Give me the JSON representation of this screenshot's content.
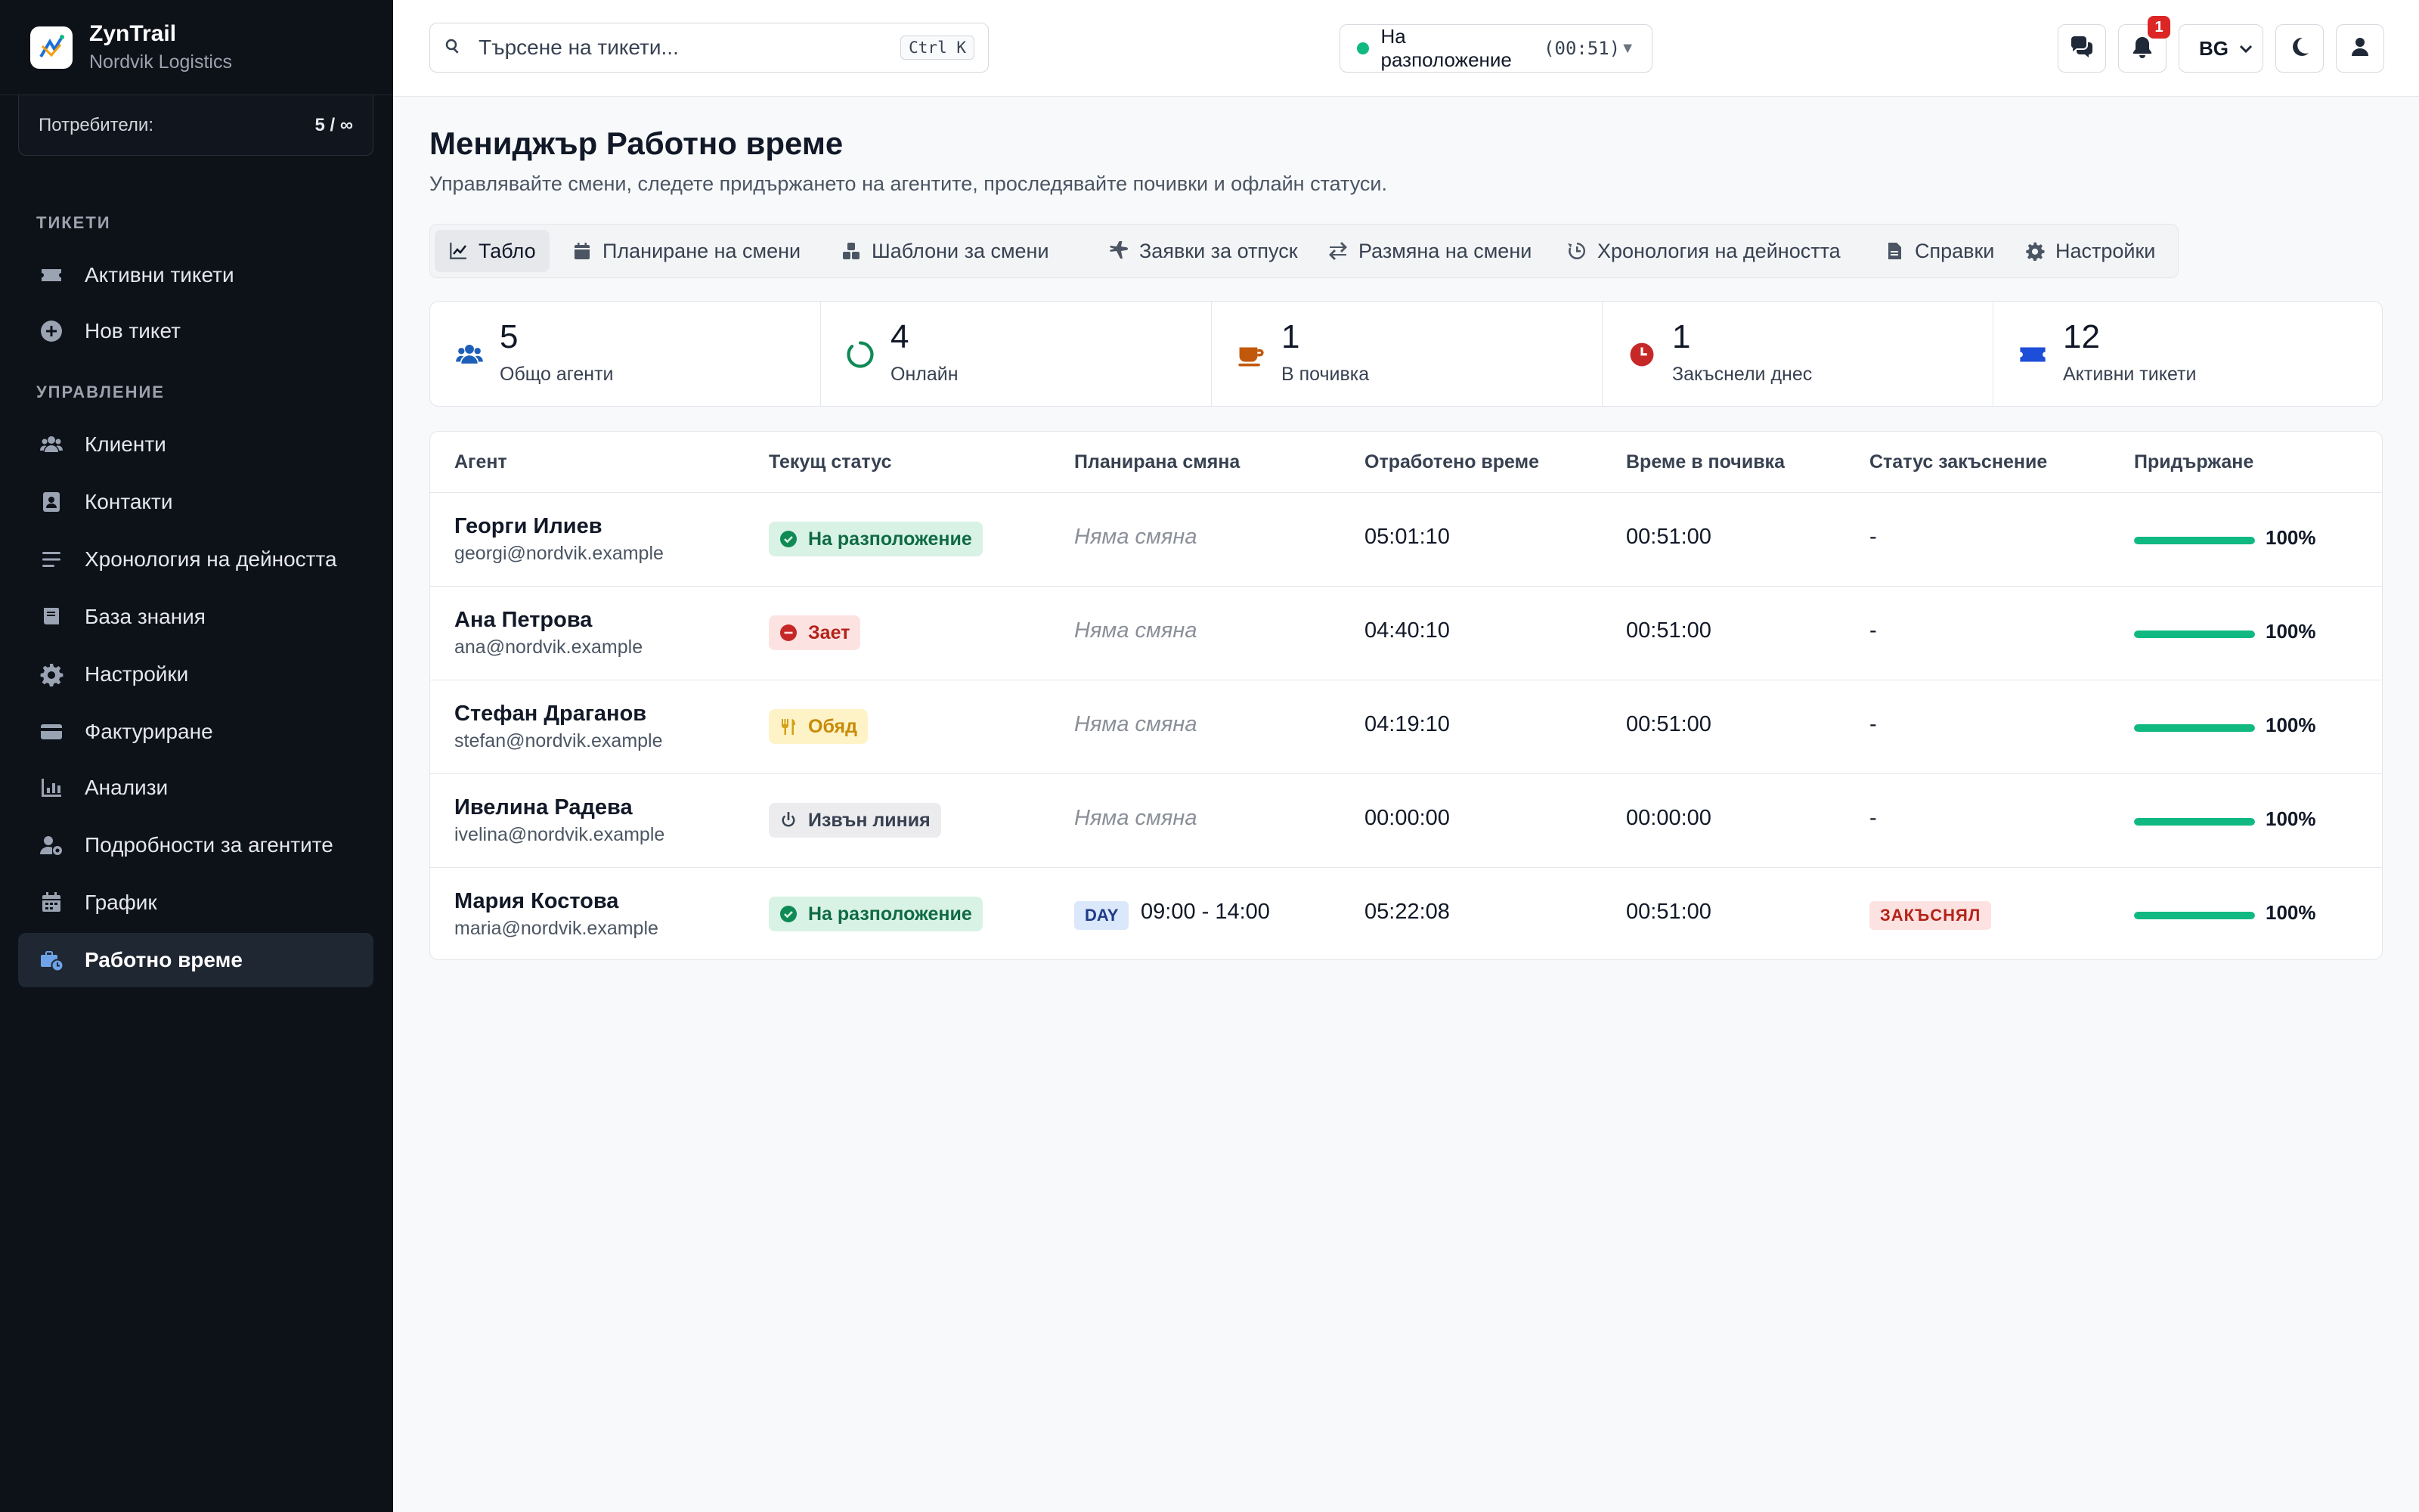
{
  "brand": {
    "name": "ZynTrail",
    "org": "Nordvik Logistics"
  },
  "users": {
    "label": "Потребители:",
    "value": "5 / ∞"
  },
  "sidebar": {
    "section_tickets": "ТИКЕТИ",
    "section_management": "УПРАВЛЕНИЕ",
    "items": [
      {
        "label": "Активни тикети",
        "icon": "ticket-icon"
      },
      {
        "label": "Нов тикет",
        "icon": "plus-circle-icon"
      },
      {
        "label": "Клиенти",
        "icon": "users-icon"
      },
      {
        "label": "Контакти",
        "icon": "address-book-icon"
      },
      {
        "label": "Хронология на дейността",
        "icon": "list-icon"
      },
      {
        "label": "База знания",
        "icon": "book-icon"
      },
      {
        "label": "Настройки",
        "icon": "gear-icon"
      },
      {
        "label": "Фактуриране",
        "icon": "credit-card-icon"
      },
      {
        "label": "Анализи",
        "icon": "chart-icon"
      },
      {
        "label": "Подробности за агентите",
        "icon": "user-gear-icon"
      },
      {
        "label": "График",
        "icon": "calendar-icon"
      },
      {
        "label": "Работно време",
        "icon": "business-time-icon",
        "active": true
      }
    ]
  },
  "search": {
    "placeholder": "Търсене на тикети...",
    "shortcut": "Ctrl K"
  },
  "presence": {
    "label": "На разположение",
    "timer": "(00:51)",
    "color": "#10b981"
  },
  "notifications": {
    "count": "1"
  },
  "language": "BG",
  "page": {
    "title": "Мениджър Работно време",
    "subtitle": "Управлявайте смени, следете придържането на агентите, проследявайте почивки и офлайн статуси."
  },
  "tabs": [
    {
      "label": "Табло",
      "icon": "chart-line-icon",
      "active": true
    },
    {
      "label": "Планиране на смени",
      "icon": "calendar-icon"
    },
    {
      "label": "Шаблони за смени",
      "icon": "cubes-icon"
    },
    {
      "label": "Заявки за отпуск",
      "icon": "plane-icon"
    },
    {
      "label": "Размяна на смени",
      "icon": "exchange-icon"
    },
    {
      "label": "Хронология на дейността",
      "icon": "history-icon"
    },
    {
      "label": "Справки",
      "icon": "file-icon"
    },
    {
      "label": "Настройки",
      "icon": "gear-icon"
    }
  ],
  "stats": [
    {
      "value": "5",
      "label": "Общо агенти",
      "icon": "users-icon",
      "color": "#1d5fb8"
    },
    {
      "value": "4",
      "label": "Онлайн",
      "icon": "circle-notch-icon",
      "color": "#0f8a55"
    },
    {
      "value": "1",
      "label": "В почивка",
      "icon": "coffee-icon",
      "color": "#c2580a"
    },
    {
      "value": "1",
      "label": "Закъснели днес",
      "icon": "clock-icon",
      "color": "#c62828"
    },
    {
      "value": "12",
      "label": "Активни тикети",
      "icon": "ticket-icon",
      "color": "#1d4ed8"
    }
  ],
  "table": {
    "headers": [
      "Агент",
      "Текущ статус",
      "Планирана смяна",
      "Отработено време",
      "Време в почивка",
      "Статус закъснение",
      "Придържане"
    ],
    "rows": [
      {
        "name": "Георги Илиев",
        "email": "georgi@nordvik.example",
        "status": "На разположение",
        "status_type": "green",
        "shift": "Няма смяна",
        "worked": "05:01:10",
        "break": "00:51:00",
        "late": "-",
        "adherence": "100%",
        "adherence_value": 1.0
      },
      {
        "name": "Ана Петрова",
        "email": "ana@nordvik.example",
        "status": "Зает",
        "status_type": "red",
        "shift": "Няма смяна",
        "worked": "04:40:10",
        "break": "00:51:00",
        "late": "-",
        "adherence": "100%",
        "adherence_value": 1.0
      },
      {
        "name": "Стефан Драганов",
        "email": "stefan@nordvik.example",
        "status": "Обяд",
        "status_type": "yellow",
        "shift": "Няма смяна",
        "worked": "04:19:10",
        "break": "00:51:00",
        "late": "-",
        "adherence": "100%",
        "adherence_value": 1.0
      },
      {
        "name": "Ивелина Радева",
        "email": "ivelina@nordvik.example",
        "status": "Извън линия",
        "status_type": "gray",
        "shift": "Няма смяна",
        "worked": "00:00:00",
        "break": "00:00:00",
        "late": "-",
        "adherence": "100%",
        "adherence_value": 1.0
      },
      {
        "name": "Мария Костова",
        "email": "maria@nordvik.example",
        "status": "На разположение",
        "status_type": "green",
        "shift_tag": "DAY",
        "shift_time": "09:00 - 14:00",
        "worked": "05:22:08",
        "break": "00:51:00",
        "late_tag": "ЗАКЪСНЯЛ",
        "adherence": "100%",
        "adherence_value": 1.0
      }
    ]
  }
}
